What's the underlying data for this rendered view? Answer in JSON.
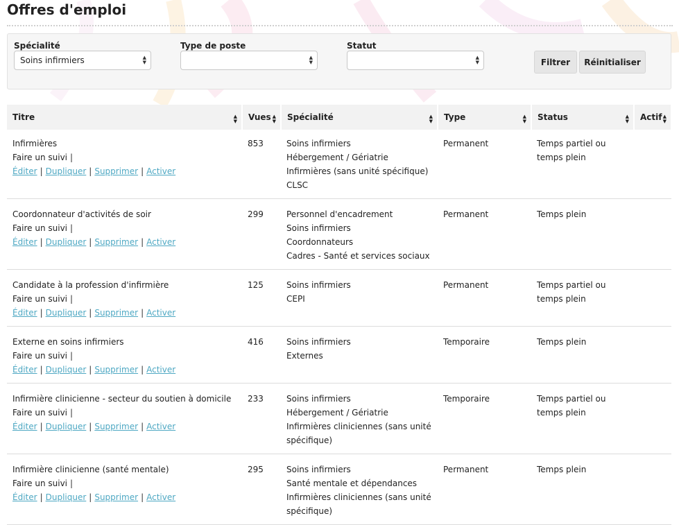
{
  "page": {
    "title": "Offres d'emploi"
  },
  "filters": {
    "specialite": {
      "label": "Spécialité",
      "value": "Soins infirmiers"
    },
    "type_poste": {
      "label": "Type de poste",
      "value": ""
    },
    "statut": {
      "label": "Statut",
      "value": ""
    },
    "filter_button": "Filtrer",
    "reset_button": "Réinitialiser"
  },
  "table": {
    "columns": [
      "Titre",
      "Vues",
      "Spécialité",
      "Type",
      "Status",
      "Actif"
    ],
    "actions": {
      "follow": "Faire un suivi",
      "edit": "Éditer",
      "duplicate": "Dupliquer",
      "delete": "Supprimer",
      "activate": "Activer",
      "separator": "|"
    },
    "rows": [
      {
        "title": "Infirmières",
        "views": "853",
        "specialties": [
          "Soins infirmiers",
          "Hébergement / Gériatrie",
          "Infirmières (sans unité spécifique)",
          "CLSC"
        ],
        "type": "Permanent",
        "status": "Temps partiel ou temps plein",
        "active": ""
      },
      {
        "title": "Coordonnateur d'activités de soir",
        "views": "299",
        "specialties": [
          "Personnel d'encadrement",
          "Soins infirmiers",
          "Coordonnateurs",
          "Cadres - Santé et services sociaux"
        ],
        "type": "Permanent",
        "status": "Temps plein",
        "active": ""
      },
      {
        "title": "Candidate à la profession d'infirmière",
        "views": "125",
        "specialties": [
          "Soins infirmiers",
          "CEPI"
        ],
        "type": "Permanent",
        "status": "Temps partiel ou temps plein",
        "active": ""
      },
      {
        "title": "Externe en soins infirmiers",
        "views": "416",
        "specialties": [
          "Soins infirmiers",
          "Externes"
        ],
        "type": "Temporaire",
        "status": "Temps plein",
        "active": ""
      },
      {
        "title": "Infirmière clinicienne - secteur du soutien à domicile",
        "views": "233",
        "specialties": [
          "Soins infirmiers",
          "Hébergement / Gériatrie",
          "Infirmières cliniciennes (sans unité spécifique)"
        ],
        "type": "Temporaire",
        "status": "Temps partiel ou temps plein",
        "active": ""
      },
      {
        "title": "Infirmière clinicienne (santé mentale)",
        "views": "295",
        "specialties": [
          "Soins infirmiers",
          "Santé mentale et dépendances",
          "Infirmières cliniciennes (sans unité spécifique)"
        ],
        "type": "Permanent",
        "status": "Temps plein",
        "active": ""
      }
    ]
  }
}
